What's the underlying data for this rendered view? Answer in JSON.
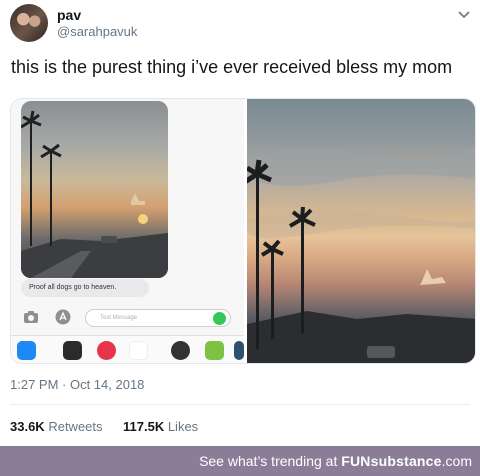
{
  "tweet": {
    "display_name": "pav",
    "handle": "@sarahpavuk",
    "text": "this is the purest thing i’ve ever received bless my mom",
    "timestamp": "1:27 PM · Oct 14, 2018",
    "retweets_count": "33.6K",
    "retweets_label": "Retweets",
    "likes_count": "117.5K",
    "likes_label": "Likes"
  },
  "imessage": {
    "bubble_text": "Proof all dogs go to heaven.",
    "input_placeholder": "Text Message",
    "app_icons": [
      "app-store-icon",
      "heart-app-icon",
      "search-globe-icon",
      "music-icon",
      "penguin-sticker-icon",
      "face-sticker-icon",
      "t-app-icon"
    ]
  },
  "footer": {
    "lead": "See what’s trending at ",
    "brand_bold": "FUNsubstance",
    "brand_rest": ".com"
  },
  "colors": {
    "footer_bg": "#8b7d98",
    "meta_gray": "#657786",
    "imessage_send": "#34c759"
  }
}
